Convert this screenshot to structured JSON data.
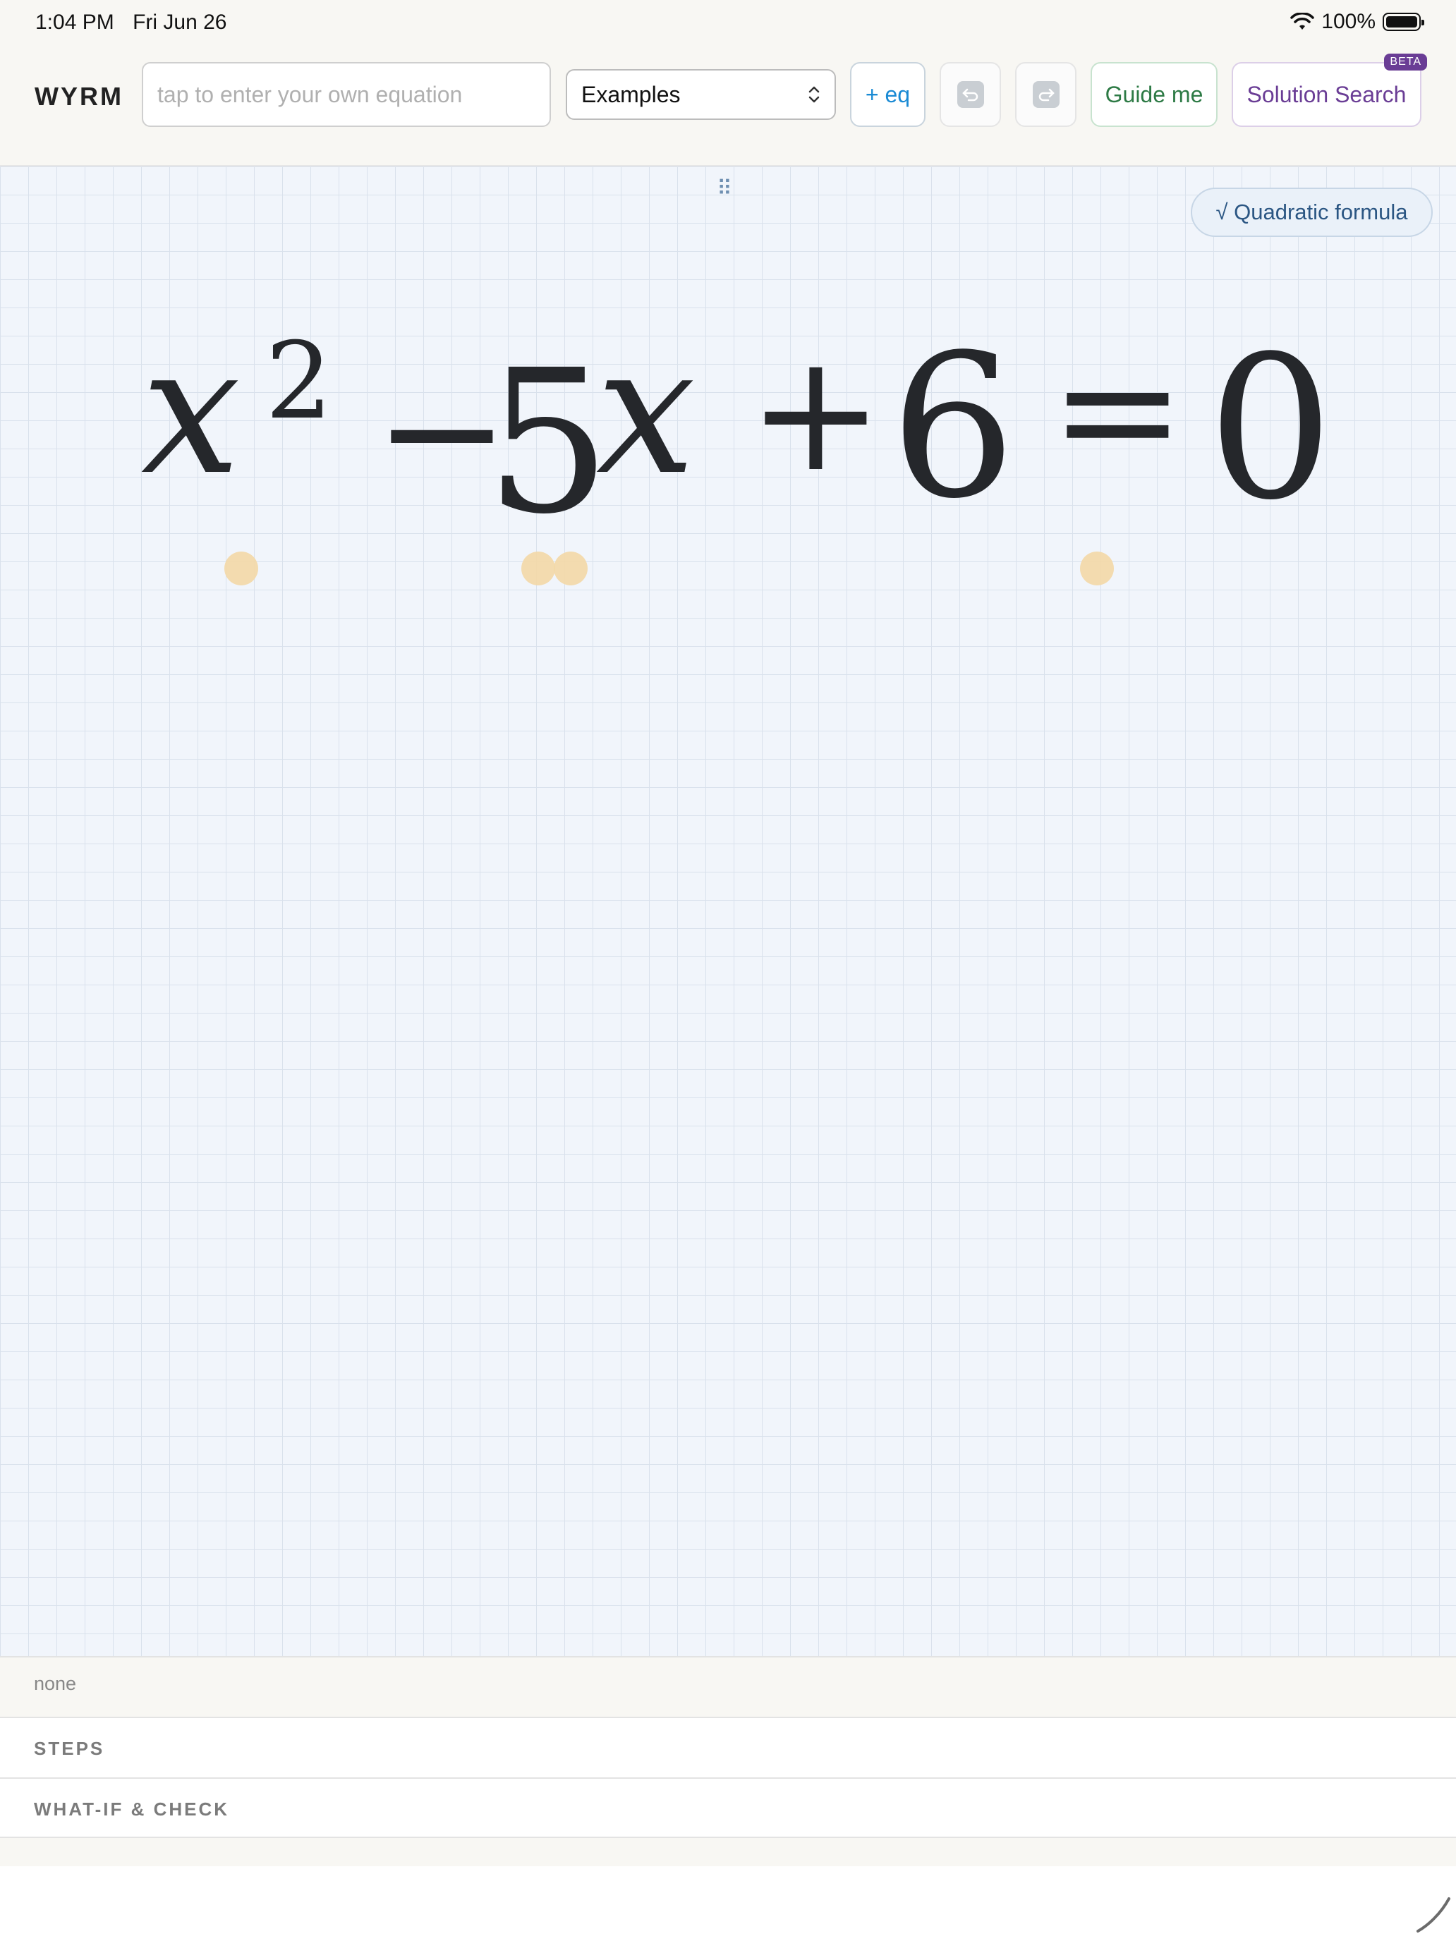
{
  "status": {
    "time": "1:04 PM",
    "date": "Fri Jun 26",
    "battery": "100%"
  },
  "toolbar": {
    "brand": "WYRM",
    "input_placeholder": "tap to enter your own equation",
    "examples_label": "Examples",
    "add_eq_label": "+ eq",
    "guide_label": "Guide me",
    "search_label": "Solution Search",
    "beta_label": "BETA"
  },
  "canvas": {
    "drag_handle": "⠿",
    "quadratic_chip": "√ Quadratic formula",
    "equation": {
      "x1": "x",
      "exp": "2",
      "minus": "−",
      "five": "5",
      "x2": "x",
      "plus": "+",
      "six": "6",
      "equals": "=",
      "zero": "0"
    }
  },
  "panels": {
    "none": "none",
    "steps": "STEPS",
    "whatif": "WHAT-IF & CHECK"
  },
  "colors": {
    "accent_blue": "#1a8ad4",
    "guide_green": "#2d7a45",
    "search_purple": "#6a3d95",
    "dot_orange": "#f3d8a6"
  }
}
